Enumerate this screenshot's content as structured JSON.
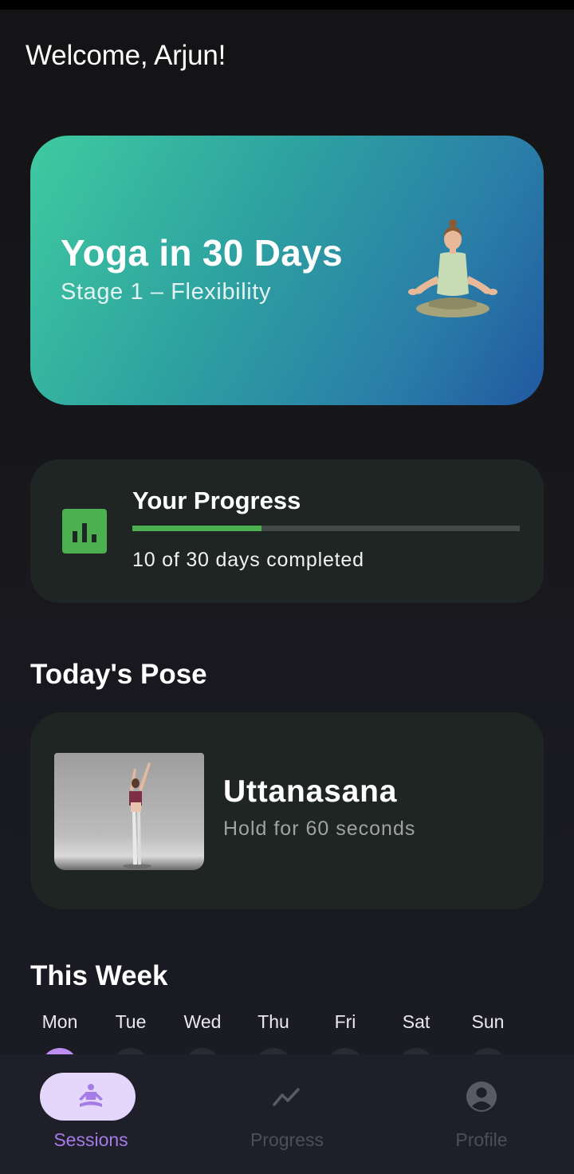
{
  "header": {
    "welcome": "Welcome, Arjun!"
  },
  "hero": {
    "title": "Yoga in 30 Days",
    "subtitle": "Stage 1 – Flexibility",
    "illustration_icon": "meditating-person-illustration"
  },
  "progress": {
    "title": "Your Progress",
    "icon": "bar-chart-icon",
    "completed_days": 10,
    "total_days": 30,
    "fraction": 0.3333,
    "text": "10 of 30 days completed"
  },
  "today": {
    "section_title": "Today's Pose",
    "pose_name": "Uttanasana",
    "hold_text": "Hold for 60 seconds"
  },
  "week": {
    "section_title": "This Week",
    "days": [
      "Mon",
      "Tue",
      "Wed",
      "Thu",
      "Fri",
      "Sat",
      "Sun"
    ],
    "active_index": 0
  },
  "nav": {
    "items": [
      {
        "label": "Sessions",
        "icon": "meditation-icon",
        "active": true
      },
      {
        "label": "Progress",
        "icon": "trending-line-icon",
        "active": false
      },
      {
        "label": "Profile",
        "icon": "account-circle-icon",
        "active": false
      }
    ]
  },
  "colors": {
    "accent_purple": "#a57be8",
    "progress_green": "#4caf50",
    "card_bg": "#1f2523",
    "hero_gradient_start": "#3fcaa0",
    "hero_gradient_end": "#2158a0",
    "nav_inactive": "#5a5a66"
  }
}
